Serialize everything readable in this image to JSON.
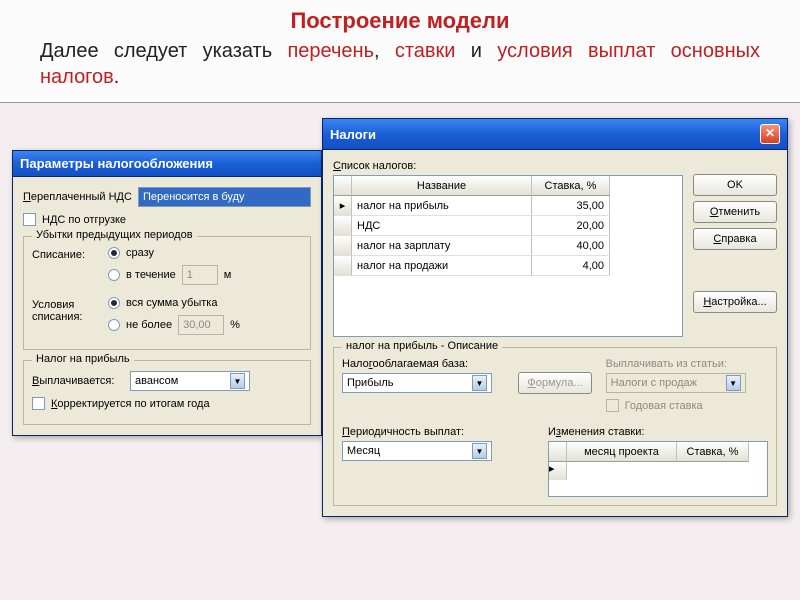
{
  "header": {
    "title": "Построение модели",
    "line_p1": "Далее следует указать ",
    "kw1": "перечень",
    "sep1": ", ",
    "kw2": "ставки",
    "line_p2": " и ",
    "kw3": "условия выплат основных налогов",
    "tail": "."
  },
  "win_params": {
    "title": "Параметры налогообложения",
    "overpaid_label": "Переплаченный НДС",
    "overpaid_value": "Переносится в буду",
    "nds_ship": "НДС по отгрузке",
    "losses_group": "Убытки предыдущих периодов",
    "writeoff_label": "Списание:",
    "opt_immediate": "сразу",
    "opt_during": "в течение",
    "during_val": "1",
    "during_unit": "м",
    "cond_label": "Условия списания:",
    "opt_full": "вся сумма убытка",
    "opt_max": "не более",
    "max_val": "30,00",
    "max_unit": "%",
    "profit_group": "Налог на прибыль",
    "paid_label": "Выплачивается:",
    "paid_val": "авансом",
    "corrected": "Корректируется по итогам года"
  },
  "win_tax": {
    "title": "Налоги",
    "list_label": "Список налогов:",
    "col_name": "Название",
    "col_rate": "Ставка, %",
    "rows": [
      {
        "name": "налог на прибыль",
        "rate": "35,00"
      },
      {
        "name": "НДС",
        "rate": "20,00"
      },
      {
        "name": "налог на зарплату",
        "rate": "40,00"
      },
      {
        "name": "налог на продажи",
        "rate": "4,00"
      }
    ],
    "ok": "OK",
    "cancel": "Отменить",
    "help": "Справка",
    "setup": "Настройка...",
    "desc_group": "налог на прибыль - Описание",
    "base_label": "Налогооблагаемая база:",
    "base_val": "Прибыль",
    "formula": "Формула...",
    "payfrom_label": "Выплачивать из статьи:",
    "payfrom_val": "Налоги с продаж",
    "annual": "Годовая ставка",
    "period_label": "Периодичность выплат:",
    "period_val": "Месяц",
    "changes_label": "Изменения ставки:",
    "chg_col1": "месяц проекта",
    "chg_col2": "Ставка, %"
  }
}
